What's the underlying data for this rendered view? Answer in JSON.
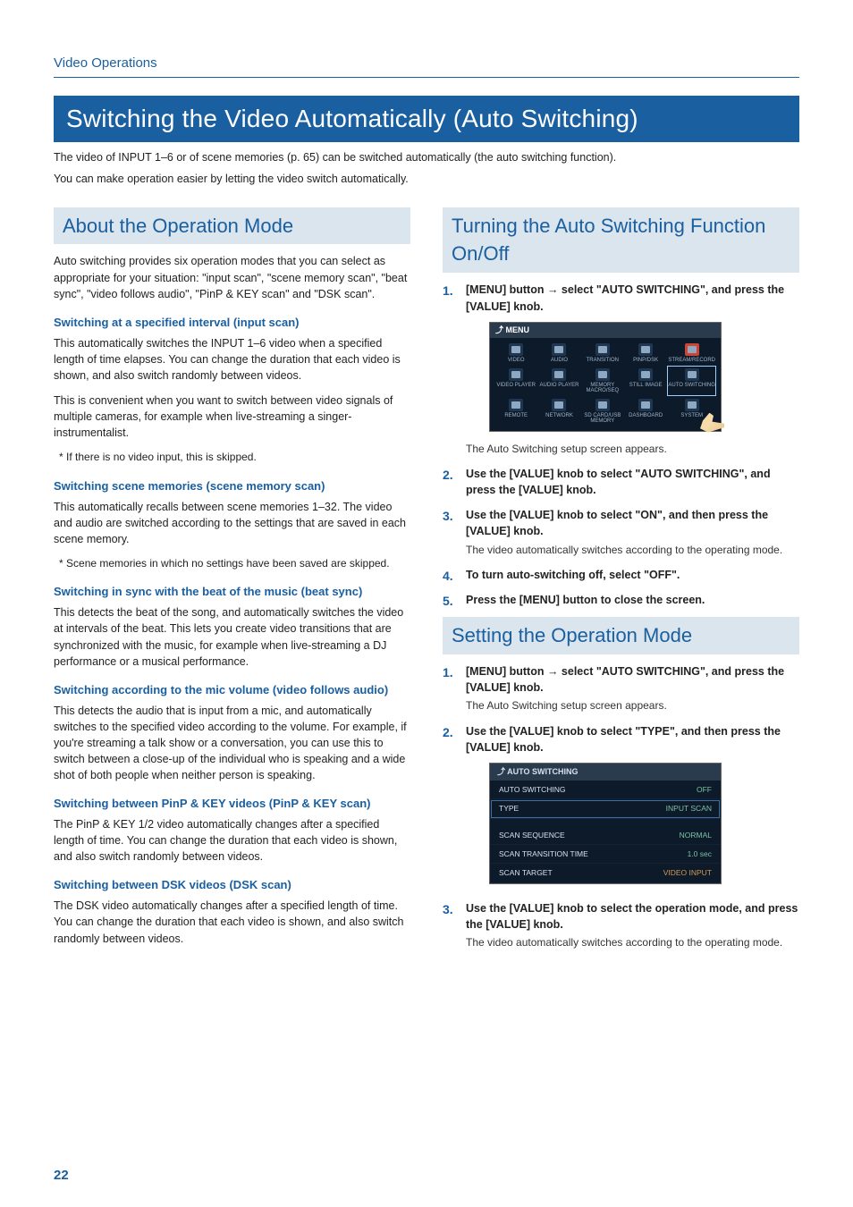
{
  "pageNumber": "22",
  "header": "Video Operations",
  "title": "Switching the Video Automatically (Auto Switching)",
  "intro1": "The video of INPUT 1–6 or of scene memories (p. 65) can be switched automatically (the auto switching function).",
  "intro2": "You can make operation easier by letting the video switch automatically.",
  "left": {
    "section": "About the Operation Mode",
    "para1": "Auto switching provides six operation modes that you can select as appropriate for your situation: \"input scan\", \"scene memory scan\", \"beat sync\", \"video follows audio\", \"PinP & KEY scan\" and \"DSK scan\".",
    "h1": "Switching at a specified interval (input scan)",
    "p1a": "This automatically switches the INPUT 1–6 video when a specified length of time elapses. You can change the duration that each video is shown, and also switch randomly between videos.",
    "p1b": "This is convenient when you want to switch between video signals of multiple cameras, for example when live-streaming a singer-instrumentalist.",
    "n1": "If there is no video input, this is skipped.",
    "h2": "Switching scene memories (scene memory scan)",
    "p2": "This automatically recalls between scene memories 1–32. The video and audio are switched according to the settings that are saved in each scene memory.",
    "n2": "Scene memories in which no settings have been saved are skipped.",
    "h3": "Switching in sync with the beat of the music (beat sync)",
    "p3": "This detects the beat of the song, and automatically switches the video at intervals of the beat. This lets you create video transitions that are synchronized with the music, for example when live-streaming a DJ performance or a musical performance.",
    "h4": "Switching according to the mic volume (video follows audio)",
    "p4": "This detects the audio that is input from a mic, and automatically switches to the specified video according to the volume. For example, if you're streaming a talk show or a conversation, you can use this to switch between a close-up of the individual who is speaking and a wide shot of both people when neither person is speaking.",
    "h5": "Switching between PinP & KEY videos (PinP & KEY scan)",
    "p5": "The PinP & KEY 1/2 video automatically changes after a specified length of time. You can change the duration that each video is shown, and also switch randomly between videos.",
    "h6": "Switching between DSK videos (DSK scan)",
    "p6": "The DSK video automatically changes after a specified length of time. You can change the duration that each video is shown, and also switch randomly between videos."
  },
  "right": {
    "sectionA": "Turning the Auto Switching Function On/Off",
    "a1main": "[MENU] button → select \"AUTO SWITCHING\", and press the [VALUE] knob.",
    "a1sub": "The Auto Switching setup screen appears.",
    "a2main": "Use the [VALUE] knob to select \"AUTO SWITCHING\", and press the [VALUE] knob.",
    "a3main": "Use the [VALUE] knob to select \"ON\", and then press the [VALUE] knob.",
    "a3sub": "The video automatically switches according to the operating mode.",
    "a4main": "To turn auto-switching off, select \"OFF\".",
    "a5main": "Press the [MENU] button to close the screen.",
    "sectionB": "Setting the Operation Mode",
    "b1main": "[MENU] button → select \"AUTO SWITCHING\", and press the [VALUE] knob.",
    "b1sub": "The Auto Switching setup screen appears.",
    "b2main": "Use the [VALUE] knob to select \"TYPE\", and then press the [VALUE] knob.",
    "b3main": "Use the [VALUE] knob to select the operation mode, and press the [VALUE] knob.",
    "b3sub": "The video automatically switches according to the operating mode."
  },
  "menuShot": {
    "title": "⤴ MENU",
    "items": [
      "VIDEO",
      "AUDIO",
      "TRANSITION",
      "PINP/DSK",
      "STREAM/RECORD",
      "VIDEO PLAYER",
      "AUDIO PLAYER",
      "MEMORY MACRO/SEQ",
      "STILL IMAGE",
      "AUTO SWITCHING",
      "REMOTE",
      "NETWORK",
      "SD CARD/USB MEMORY",
      "DASHBOARD",
      "SYSTEM"
    ]
  },
  "settingsShot": {
    "title": "⤴ AUTO SWITCHING",
    "rows": [
      {
        "label": "AUTO SWITCHING",
        "value": "OFF",
        "valClass": ""
      },
      {
        "label": "TYPE",
        "value": "INPUT SCAN",
        "valClass": "",
        "sel": true
      },
      {
        "label": "",
        "value": "",
        "gap": true
      },
      {
        "label": "SCAN SEQUENCE",
        "value": "NORMAL",
        "valClass": ""
      },
      {
        "label": "SCAN TRANSITION TIME",
        "value": "1.0 sec",
        "valClass": ""
      },
      {
        "label": "SCAN TARGET",
        "value": "VIDEO INPUT",
        "valClass": "orange"
      }
    ]
  }
}
